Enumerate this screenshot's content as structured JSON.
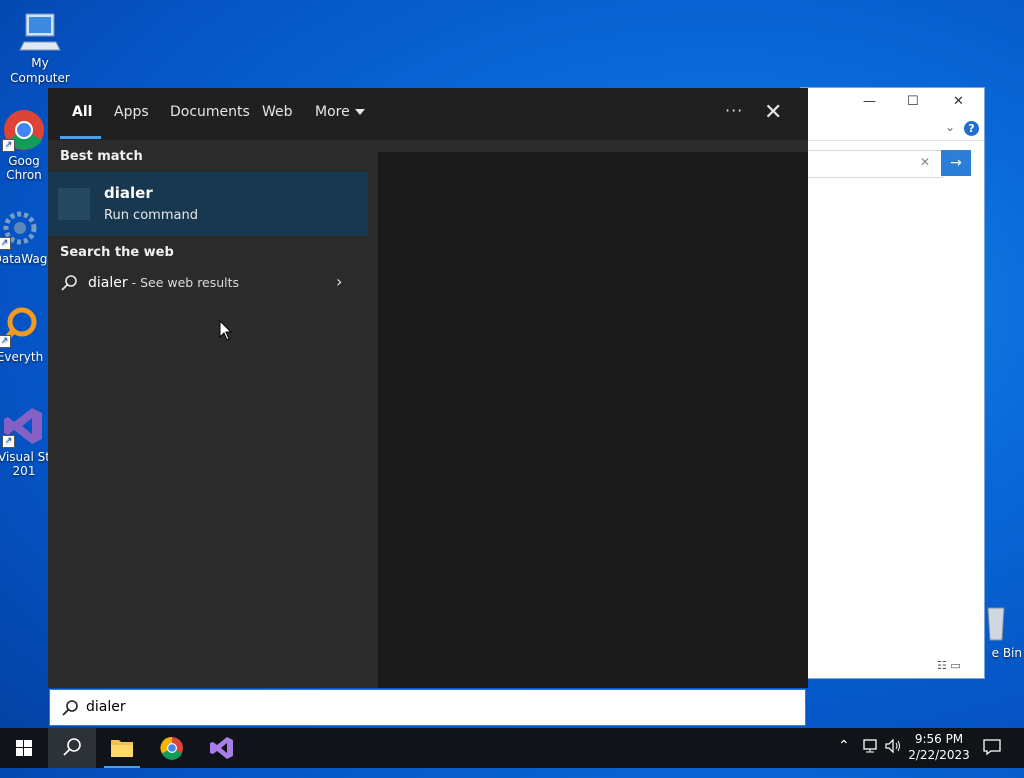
{
  "desktop": {
    "icons": [
      {
        "label": "My Computer"
      },
      {
        "label": "Goog\nChron"
      },
      {
        "label": "DataWag"
      },
      {
        "label": "Everyth"
      },
      {
        "label": "Visual St\n201"
      },
      {
        "label": "e Bin"
      }
    ]
  },
  "search": {
    "tabs": [
      "All",
      "Apps",
      "Documents",
      "Web",
      "More"
    ],
    "active_tab": "All",
    "more_options_label": "···",
    "best_match": {
      "heading": "Best match",
      "title": "dialer",
      "subtitle": "Run command"
    },
    "web": {
      "heading": "Search the web",
      "query": "dialer",
      "suffix": " - See web results"
    },
    "input_value": "dialer"
  },
  "taskbar": {
    "time": "9:56 PM",
    "date": "2/22/2023"
  },
  "colors": {
    "accent": "#4aa0f0",
    "panel_bg": "#2b2b2b",
    "selected_bg": "#18384f",
    "taskbar_bg": "#101418"
  }
}
